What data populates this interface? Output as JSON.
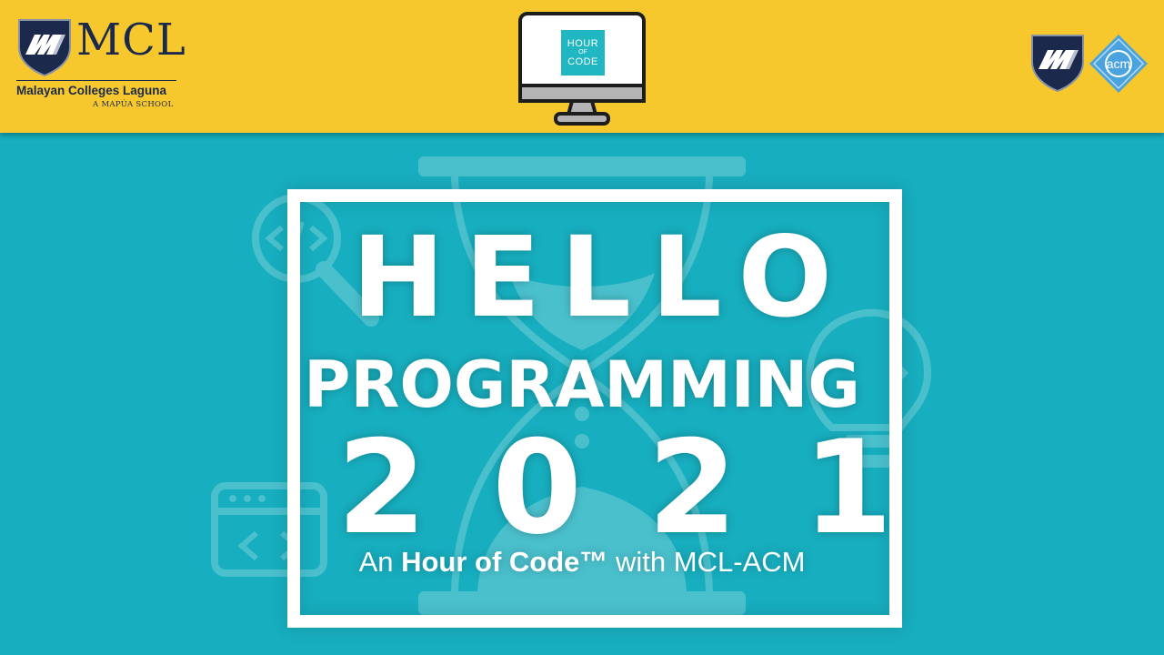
{
  "header": {
    "mcl_logo": {
      "wordmark": "MCL",
      "name": "Malayan Colleges Laguna",
      "tagline": "A MAPÚA SCHOOL",
      "shield_icon": "mcl-shield-icon"
    },
    "monitor": {
      "icon": "computer-monitor-icon",
      "badge_line1": "HOUR",
      "badge_line2": "OF",
      "badge_line3": "CODE"
    },
    "partner_logos": {
      "shield_icon": "mcl-shield-icon",
      "acm_icon": "acm-diamond-icon",
      "acm_text": "acm"
    }
  },
  "main": {
    "line1": "HELLO",
    "line2": "PROGRAMMING",
    "line3": "2021",
    "subtitle_prefix": "An ",
    "subtitle_bold": "Hour of Code™",
    "subtitle_suffix": " with MCL-ACM"
  },
  "colors": {
    "header_bg": "#f6c82e",
    "main_bg": "#17aebf",
    "navy": "#1b2a4c",
    "frame": "#ffffff",
    "acm_blue": "#4aa3dd"
  }
}
